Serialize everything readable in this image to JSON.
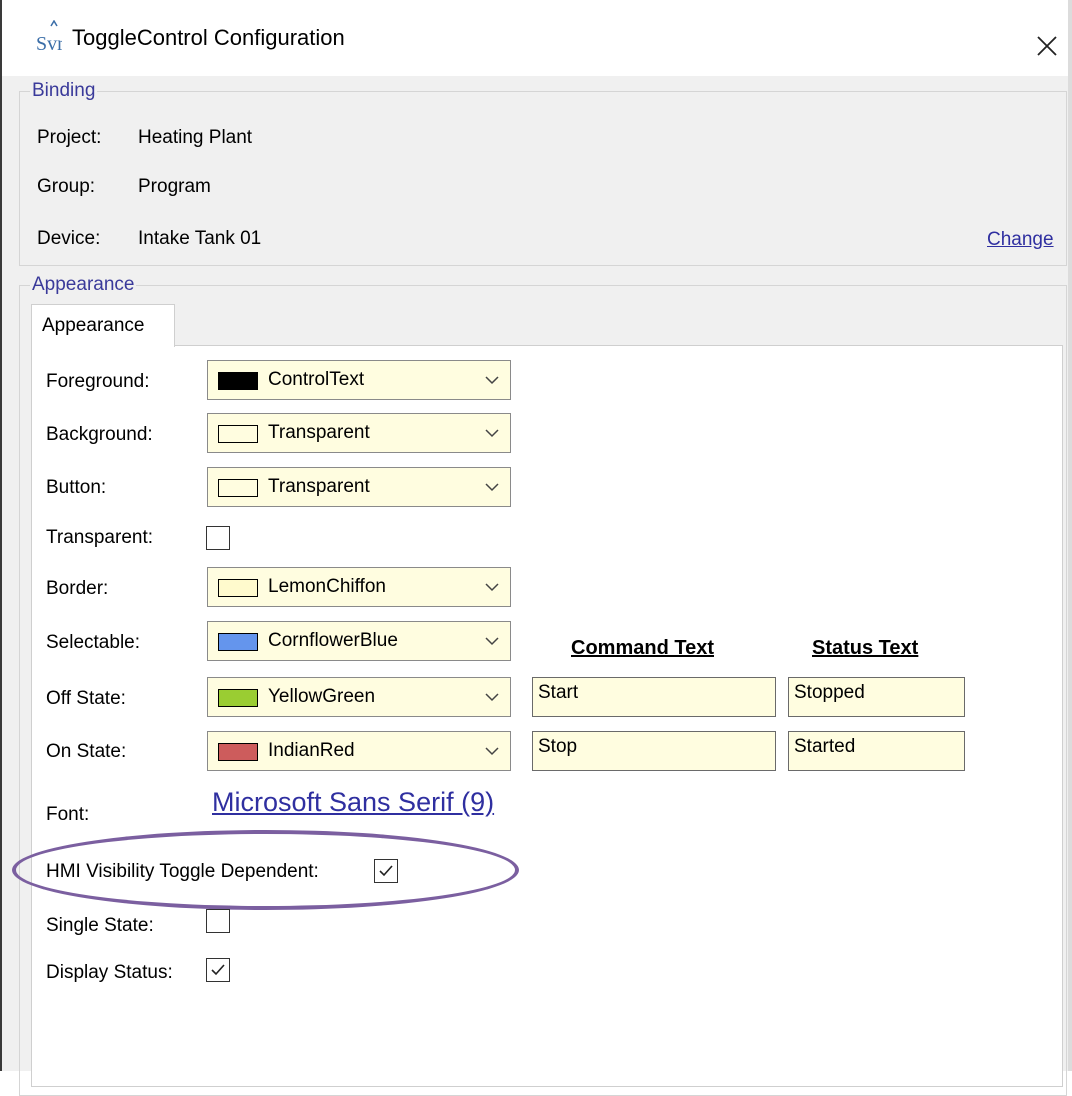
{
  "window": {
    "title": "ToggleControl Configuration",
    "app_icon_text": "Svr"
  },
  "binding": {
    "legend": "Binding",
    "project_label": "Project:",
    "project_value": "Heating Plant",
    "group_label": "Group:",
    "group_value": "Program",
    "device_label": "Device:",
    "device_value": "Intake Tank 01",
    "change_link": "Change"
  },
  "appearance": {
    "legend": "Appearance",
    "tab_label": "Appearance",
    "rows": {
      "foreground": {
        "label": "Foreground:",
        "value": "ControlText",
        "swatch": "#000000"
      },
      "background": {
        "label": "Background:",
        "value": "Transparent",
        "swatch": "#fffde0"
      },
      "button": {
        "label": "Button:",
        "value": "Transparent",
        "swatch": "#fffde0"
      },
      "transparent": {
        "label": "Transparent:",
        "checked": false
      },
      "border": {
        "label": "Border:",
        "value": "LemonChiffon",
        "swatch": "#fffacd"
      },
      "selectable": {
        "label": "Selectable:",
        "value": "CornflowerBlue",
        "swatch": "#6495ed"
      },
      "off_state": {
        "label": "Off State:",
        "value": "YellowGreen",
        "swatch": "#9acd32",
        "command": "Start",
        "status": "Stopped"
      },
      "on_state": {
        "label": "On State:",
        "value": "IndianRed",
        "swatch": "#cd5c5c",
        "command": "Stop",
        "status": "Started"
      }
    },
    "command_header": "Command Text",
    "status_header": "Status Text",
    "font_label": "Font:",
    "font_value": "Microsoft Sans Serif (9)",
    "hmi_label": "HMI Visibility Toggle Dependent:",
    "hmi_checked": true,
    "single_state_label": "Single State:",
    "single_state_checked": false,
    "display_status_label": "Display Status:",
    "display_status_checked": true
  },
  "colors": {
    "field_background": "#fffde0",
    "legend_text": "#3a3a9a",
    "link": "#2f2fa0",
    "highlight_ellipse": "#7b5fa0"
  },
  "icons": {
    "app": "svr-app-icon",
    "close": "close-icon",
    "dropdown": "chevron-down-icon",
    "check": "checkmark-icon"
  }
}
